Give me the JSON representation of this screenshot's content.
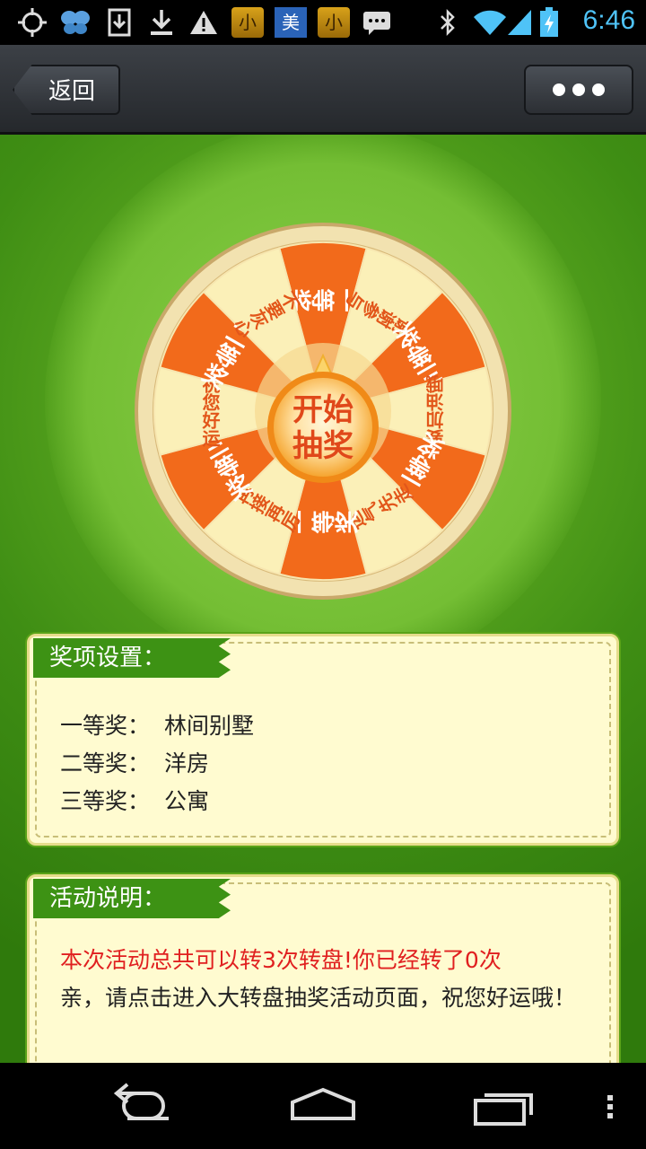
{
  "status_bar": {
    "time": "6:46",
    "app_badge_1": "小",
    "app_badge_mei": "美",
    "app_badge_2": "小"
  },
  "nav": {
    "back_label": "返回"
  },
  "wheel": {
    "start_line1": "开始",
    "start_line2": "抽奖",
    "segments": [
      "一等奖",
      "谢谢参与",
      "三等奖",
      "要加油哦",
      "二等奖",
      "运气先走",
      "一等奖",
      "再接再厉",
      "三等奖",
      "祝您好运",
      "二等奖",
      "不要灰心"
    ],
    "colors": {
      "orange": "#f26a1b",
      "cream": "#fbf0b8",
      "rim": "#f2e2b0",
      "text_orange_seg": "#ffffff",
      "text_cream_seg": "#e2561a"
    }
  },
  "prizes": {
    "title": "奖项设置：",
    "items": [
      {
        "level": "一等奖：",
        "prize": "林间别墅"
      },
      {
        "level": "二等奖：",
        "prize": "洋房"
      },
      {
        "level": "三等奖：",
        "prize": "公寓"
      }
    ]
  },
  "activity": {
    "title": "活动说明：",
    "line_red": "本次活动总共可以转3次转盘!你已经转了0次",
    "line_body": "亲，请点击进入大转盘抽奖活动页面，祝您好运哦！"
  }
}
